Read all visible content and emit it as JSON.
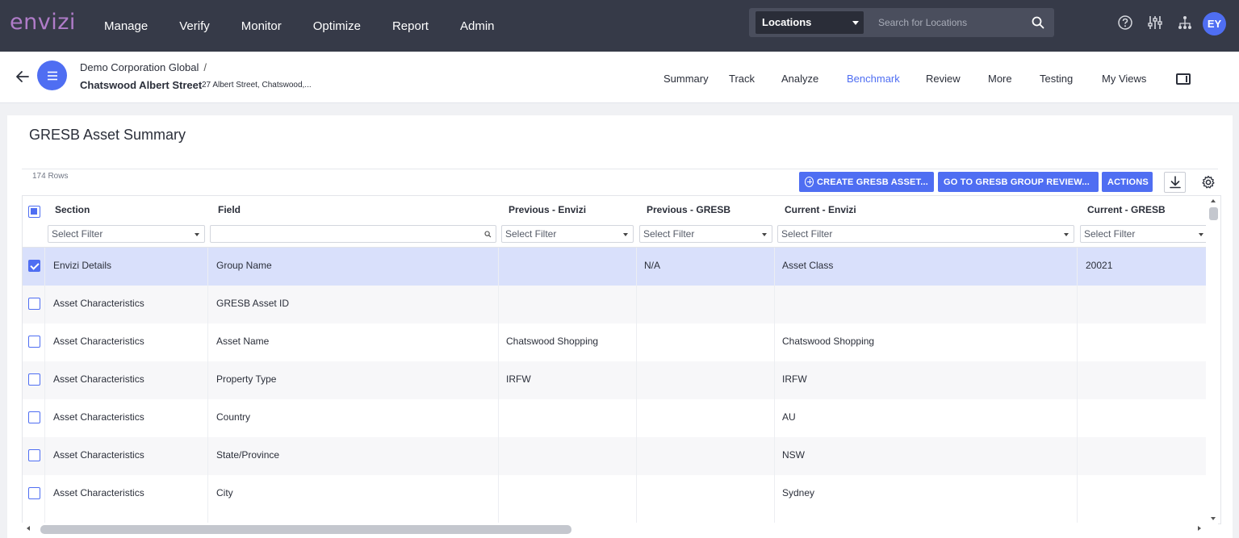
{
  "app": {
    "logo": "envizi",
    "nav": [
      "Manage",
      "Verify",
      "Monitor",
      "Optimize",
      "Report",
      "Admin"
    ],
    "location_selector": "Locations",
    "search_placeholder": "Search for Locations",
    "avatar_initials": "EY"
  },
  "breadcrumb": {
    "parent": "Demo Corporation Global",
    "separator": "/",
    "current": "Chatswood Albert Street",
    "address": "27 Albert Street, Chatswood,..."
  },
  "subnav": {
    "items": [
      "Summary",
      "Track",
      "Analyze",
      "Benchmark",
      "Review",
      "More",
      "Testing",
      "My Views"
    ],
    "active": "Benchmark"
  },
  "page": {
    "title": "GRESB Asset Summary",
    "row_count": "174 Rows"
  },
  "toolbar": {
    "create_label": "CREATE GRESB ASSET...",
    "group_review_label": "GO TO GRESB GROUP REVIEW...",
    "actions_label": "ACTIONS"
  },
  "grid": {
    "columns": [
      "Section",
      "Field",
      "Previous - Envizi",
      "Previous - GRESB",
      "Current - Envizi",
      "Current - GRESB"
    ],
    "filter_placeholder": "Select Filter",
    "rows": [
      {
        "section": "Envizi Details",
        "field": "Group Name",
        "prev_envizi": "",
        "prev_gresb": "N/A",
        "cur_envizi": "Asset Class",
        "cur_gresb": "20021",
        "selected": true
      },
      {
        "section": "Asset Characteristics",
        "field": "GRESB Asset ID",
        "prev_envizi": "",
        "prev_gresb": "",
        "cur_envizi": "",
        "cur_gresb": "",
        "selected": false
      },
      {
        "section": "Asset Characteristics",
        "field": "Asset Name",
        "prev_envizi": "Chatswood Shopping",
        "prev_gresb": "",
        "cur_envizi": "Chatswood Shopping",
        "cur_gresb": "",
        "selected": false
      },
      {
        "section": "Asset Characteristics",
        "field": "Property Type",
        "prev_envizi": "IRFW",
        "prev_gresb": "",
        "cur_envizi": "IRFW",
        "cur_gresb": "",
        "selected": false
      },
      {
        "section": "Asset Characteristics",
        "field": "Country",
        "prev_envizi": "",
        "prev_gresb": "",
        "cur_envizi": "AU",
        "cur_gresb": "",
        "selected": false
      },
      {
        "section": "Asset Characteristics",
        "field": "State/Province",
        "prev_envizi": "",
        "prev_gresb": "",
        "cur_envizi": "NSW",
        "cur_gresb": "",
        "selected": false
      },
      {
        "section": "Asset Characteristics",
        "field": "City",
        "prev_envizi": "",
        "prev_gresb": "",
        "cur_envizi": "Sydney",
        "cur_gresb": "",
        "selected": false
      }
    ]
  },
  "colors": {
    "topbar": "#363a48",
    "accent": "#4f6ef2",
    "logo": "#b07cc9",
    "selected_row": "#d9e0fb"
  },
  "icons": [
    "help-icon",
    "sliders-icon",
    "hierarchy-icon",
    "search-icon",
    "back-arrow-icon",
    "menu-icon",
    "panel-icon",
    "download-icon",
    "gear-icon"
  ]
}
